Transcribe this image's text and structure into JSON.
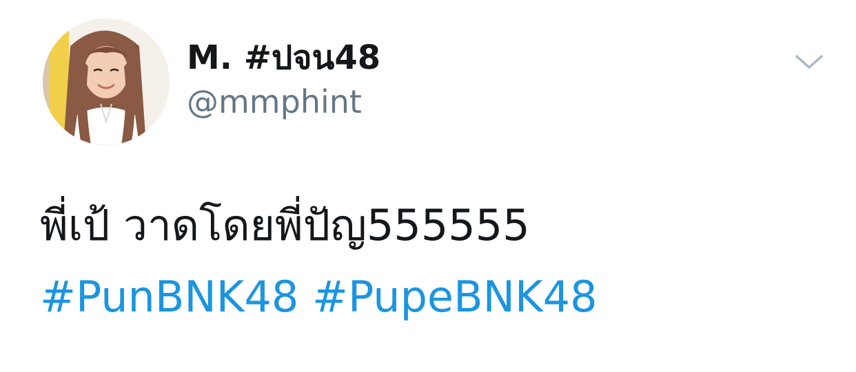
{
  "tweet": {
    "author": {
      "display_name": "M. #ปจน48",
      "handle": "@mmphint",
      "avatar_icon": "profile-photo"
    },
    "menu_icon": "chevron-down-icon",
    "text": "พี่เป้ วาดโดยพี่ปัญ555555",
    "hashtags": [
      "#PunBNK48",
      "#PupeBNK48"
    ]
  },
  "colors": {
    "text": "#14171a",
    "secondary": "#657786",
    "link": "#1b95e0",
    "chevron": "#aab8c2"
  }
}
